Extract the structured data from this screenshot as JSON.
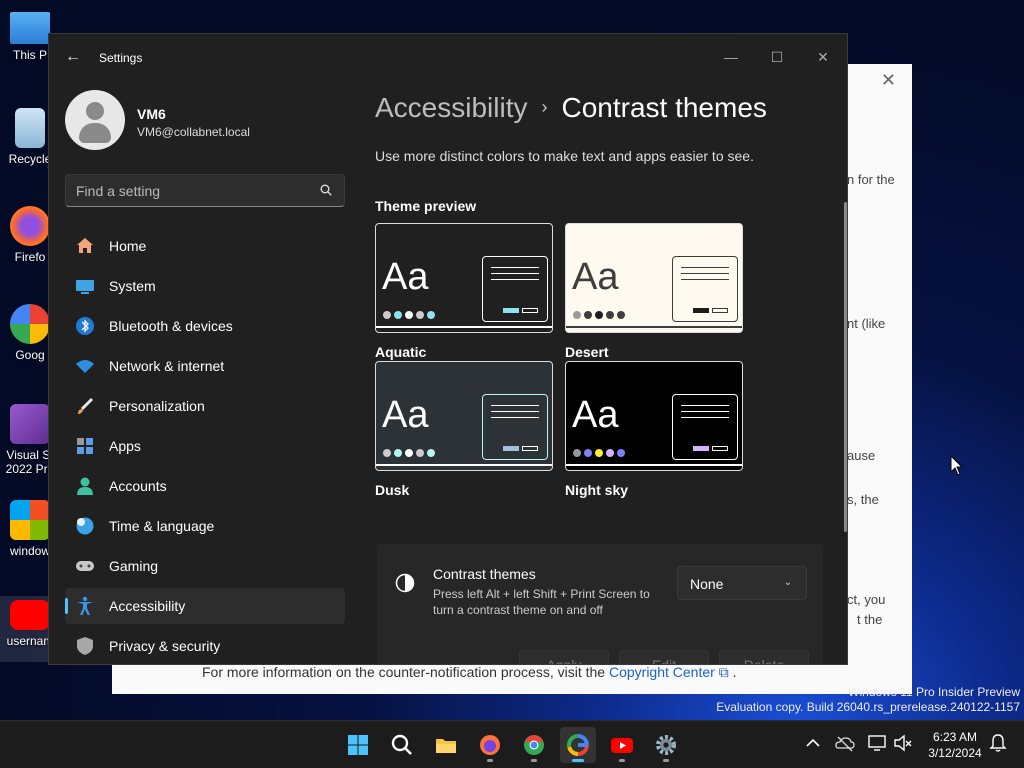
{
  "desktop": {
    "icons": [
      {
        "label": "This P"
      },
      {
        "label": "Recycle"
      },
      {
        "label": "Firefo"
      },
      {
        "label": "Goog"
      },
      {
        "label": "Visual St"
      },
      {
        "label": "2022 Pre"
      },
      {
        "label": "window"
      },
      {
        "label": "usernam"
      }
    ]
  },
  "background_window": {
    "fragments": [
      "n for the",
      "nt (like",
      "ause",
      "s, the",
      "ct, you",
      "t the"
    ],
    "footer_text": "For more information on the counter-notification process, visit the",
    "footer_link": "Copyright Center",
    "footer_end": "."
  },
  "settings": {
    "window_title": "Settings",
    "user": {
      "name": "VM6",
      "email": "VM6@collabnet.local"
    },
    "search": {
      "placeholder": "Find a setting"
    },
    "nav": [
      {
        "label": "Home",
        "icon": "home-icon"
      },
      {
        "label": "System",
        "icon": "system-icon"
      },
      {
        "label": "Bluetooth & devices",
        "icon": "bluetooth-icon"
      },
      {
        "label": "Network & internet",
        "icon": "wifi-icon"
      },
      {
        "label": "Personalization",
        "icon": "brush-icon"
      },
      {
        "label": "Apps",
        "icon": "apps-icon"
      },
      {
        "label": "Accounts",
        "icon": "accounts-icon"
      },
      {
        "label": "Time & language",
        "icon": "globe-icon"
      },
      {
        "label": "Gaming",
        "icon": "gamepad-icon"
      },
      {
        "label": "Accessibility",
        "icon": "accessibility-icon",
        "active": true
      },
      {
        "label": "Privacy & security",
        "icon": "shield-icon"
      }
    ],
    "breadcrumb": {
      "parent": "Accessibility",
      "separator": "›",
      "current": "Contrast themes"
    },
    "description": "Use more distinct colors to make text and apps easier to see.",
    "theme_preview_title": "Theme preview",
    "preview_sample": "Aa",
    "themes": [
      {
        "name": "Aquatic",
        "bg": "#202020",
        "fg": "#ffffff",
        "accent": "#8ee3f0",
        "border": "#ffffff",
        "dots": [
          "#cccccc",
          "#8ee3f0",
          "#ffffff",
          "#cccccc",
          "#8ee3f0"
        ]
      },
      {
        "name": "Desert",
        "bg": "#fffaef",
        "fg": "#3d3d3d",
        "accent": "#1c1c1c",
        "border": "#3d3d3d",
        "dots": [
          "#9a9a9a",
          "#3d3d3d",
          "#1c1c1c",
          "#3d3d3d",
          "#3d3d3d"
        ]
      },
      {
        "name": "Dusk",
        "bg": "#2d3236",
        "fg": "#ffffff",
        "accent": "#a1bfde",
        "border": "#b6f6f0",
        "dots": [
          "#cccccc",
          "#b6f6f0",
          "#ffffff",
          "#cccccc",
          "#b6f6f0"
        ]
      },
      {
        "name": "Night sky",
        "bg": "#000000",
        "fg": "#ffffff",
        "accent": "#d6b4fd",
        "border": "#ffffff",
        "dots": [
          "#999999",
          "#8080ff",
          "#ffee32",
          "#d6b4fd",
          "#8080ff"
        ]
      }
    ],
    "contrast_panel": {
      "title": "Contrast themes",
      "description": "Press left Alt + left Shift + Print Screen to turn a contrast theme on and off",
      "dropdown_value": "None",
      "buttons": {
        "apply": "Apply",
        "edit": "Edit",
        "delete": "Delete"
      }
    }
  },
  "watermark": {
    "line1": "Windows 11 Pro Insider Preview",
    "line2": "Evaluation copy. Build 26040.rs_prerelease.240122-1157"
  },
  "taskbar": {
    "time": "6:23 AM",
    "date": "3/12/2024",
    "apps": [
      "start-icon",
      "search-icon",
      "file-explorer-icon",
      "firefox-icon",
      "chrome-icon",
      "google-icon",
      "youtube-icon",
      "settings-icon"
    ]
  },
  "colors": {
    "accent": "#4cc2ff",
    "window_bg": "#202020",
    "panel_bg": "#272727"
  }
}
